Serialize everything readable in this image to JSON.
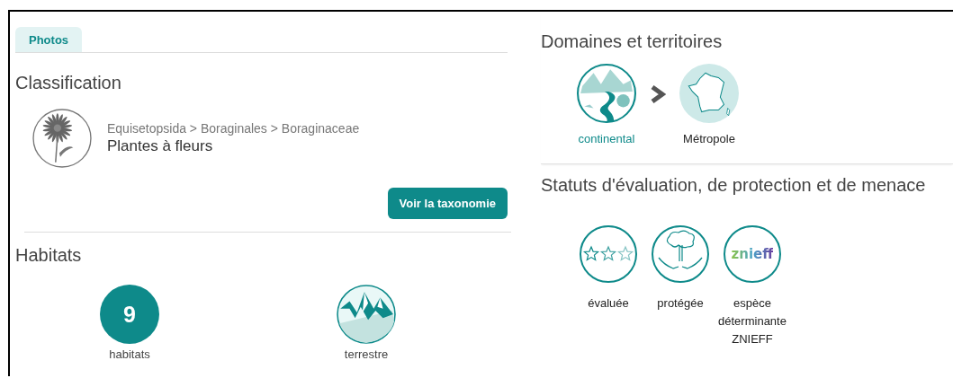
{
  "tabs": [
    {
      "label": "Photos",
      "selected": true
    }
  ],
  "classification": {
    "title": "Classification",
    "lineage": "Equisetopsida > Boraginales > Boraginaceae",
    "group": "Plantes à fleurs",
    "button": "Voir la taxonomie"
  },
  "habitats": {
    "title": "Habitats",
    "items": [
      {
        "kind": "count",
        "value": "9",
        "label": "habitats"
      },
      {
        "kind": "mountain",
        "label": "terrestre"
      }
    ]
  },
  "domains": {
    "title": "Domaines et territoires",
    "items": [
      {
        "kind": "landscape",
        "label": "continental",
        "highlighted": true
      },
      {
        "kind": "map",
        "label": "Métropole",
        "highlighted": false
      }
    ]
  },
  "statuses": {
    "title": "Statuts d'évaluation, de protection et de menace",
    "items": [
      {
        "kind": "stars",
        "label": "évaluée"
      },
      {
        "kind": "protection",
        "label": "protégée"
      },
      {
        "kind": "logo",
        "logo_text": "znieff",
        "label": "espèce déterminante ZNIEFF"
      }
    ]
  }
}
